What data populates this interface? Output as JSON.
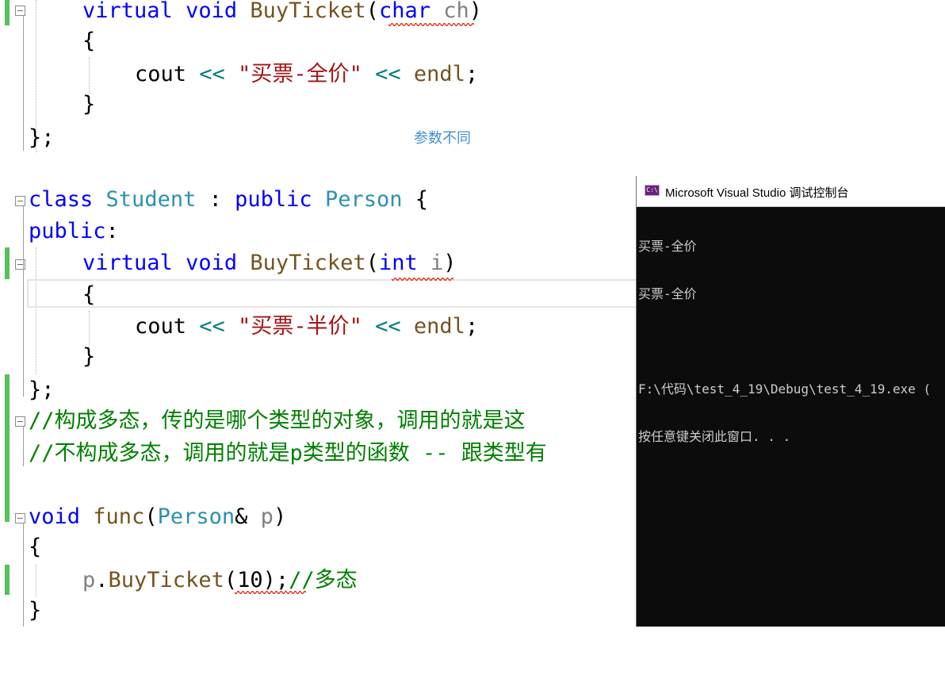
{
  "editor": {
    "lines": [
      {
        "kw1": "virtual",
        "kw2": "void",
        "fn": "BuyTicket",
        "p1": "(",
        "ptype": "char",
        "pname": "ch",
        "p2": ")"
      },
      {
        "brace": "{"
      },
      {
        "cout": "cout",
        "op1": "<<",
        "str": "\"买票-全价\"",
        "op2": "<<",
        "endl": "endl",
        "semi": ";"
      },
      {
        "brace": "}"
      },
      {
        "text": "};"
      },
      {
        "kw": "class",
        "ty": "Student",
        "colon": ":",
        "kw2": "public",
        "ty2": "Person",
        "brace": "{"
      },
      {
        "kw": "public",
        "colon": ":"
      },
      {
        "kw1": "virtual",
        "kw2": "void",
        "fn": "BuyTicket",
        "p1": "(",
        "ptype": "int",
        "pname": "i",
        "p2": ")"
      },
      {
        "brace": "{"
      },
      {
        "cout": "cout",
        "op1": "<<",
        "str": "\"买票-半价\"",
        "op2": "<<",
        "endl": "endl",
        "semi": ";"
      },
      {
        "brace": "}"
      },
      {
        "text": "};"
      },
      {
        "comment": "//构成多态，传的是哪个类型的对象，调用的就是这"
      },
      {
        "comment": "//不构成多态，调用的就是p类型的函数 -- 跟类型有"
      },
      {
        "kw": "void",
        "fn": "func",
        "p1": "(",
        "ty": "Person",
        "amp": "&",
        "pname": "p",
        "p2": ")"
      },
      {
        "brace": "{"
      },
      {
        "obj": "p",
        "dot": ".",
        "fn": "BuyTicket",
        "p1": "(",
        "num": "10",
        "p2": ")",
        "semi": ";",
        "comment": "//多态"
      },
      {
        "brace": "}"
      }
    ]
  },
  "annotation": "参数不同",
  "console": {
    "title": "Microsoft Visual Studio 调试控制台",
    "icon": "console-app-icon",
    "icon_text": "C:\\",
    "output": [
      "买票-全价",
      "买票-全价",
      "",
      "F:\\代码\\test_4_19\\Debug\\test_4_19.exe (",
      "按任意键关闭此窗口. . ."
    ]
  },
  "colors": {
    "keyword": "#0000ff",
    "type": "#2b91af",
    "function": "#74531f",
    "string": "#a31515",
    "operator": "#008080",
    "comment": "#008000",
    "change_bar": "#55c15a",
    "squiggle": "#e51400",
    "annotation": "#3e8fd8"
  }
}
